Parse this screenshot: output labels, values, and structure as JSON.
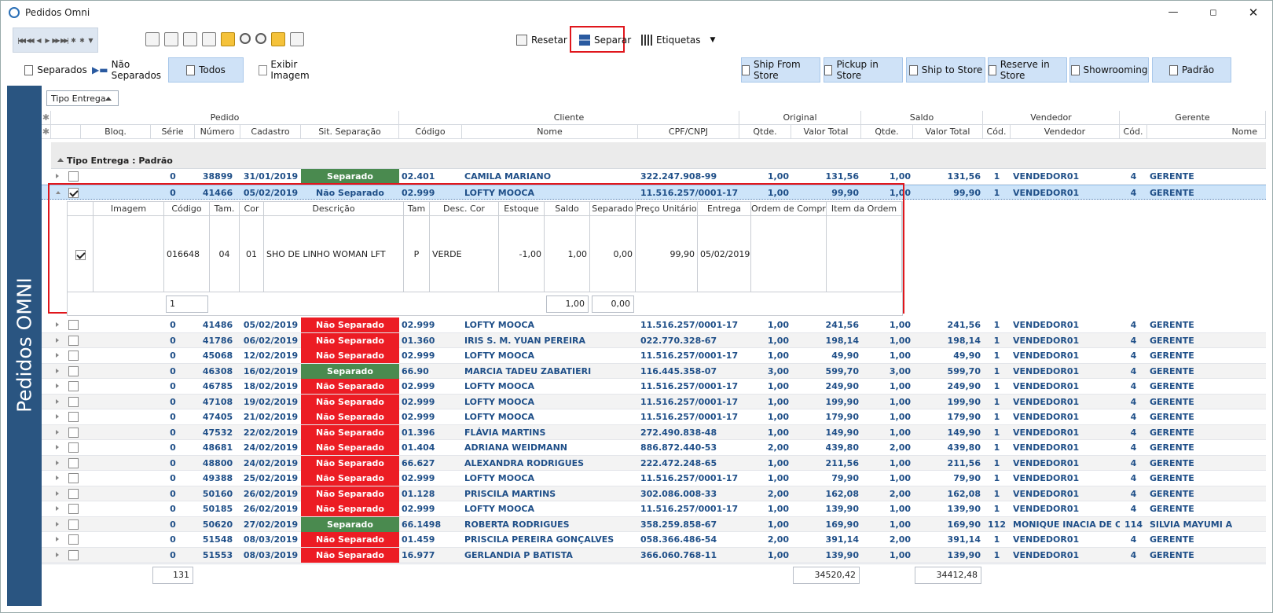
{
  "window": {
    "title": "Pedidos Omni"
  },
  "toolbar": {
    "reset_label": "Resetar",
    "separar_label": "Separar",
    "etiquetas_label": "Etiquetas"
  },
  "filters": {
    "separados": "Separados",
    "nao_separados": "Não Separados",
    "todos": "Todos",
    "exibir_imagem": "Exibir Imagem",
    "ship_from_store": "Ship From Store",
    "pickup_in_store": "Pickup in Store",
    "ship_to_store": "Ship to Store",
    "reserve_in_store": "Reserve in Store",
    "showrooming": "Showrooming",
    "padrao": "Padrão"
  },
  "sidebar": {
    "title": "Pedidos OMNI"
  },
  "grid": {
    "group_button": "Tipo Entrega",
    "band_headers": {
      "pedido": "Pedido",
      "cliente": "Cliente",
      "original": "Original",
      "saldo": "Saldo",
      "vendedor": "Vendedor",
      "gerente": "Gerente"
    },
    "columns": {
      "bloq": "Bloq.",
      "serie": "Série",
      "numero": "Número",
      "cadastro": "Cadastro",
      "sit": "Sit. Separação",
      "codigo": "Código",
      "nome": "Nome",
      "cpf": "CPF/CNPJ",
      "oqtde": "Qtde.",
      "ovalor": "Valor Total",
      "sqtde": "Qtde.",
      "svalor": "Valor Total",
      "vcod": "Cód.",
      "vendedor": "Vendedor",
      "gcod": "Cód.",
      "gnome": "Nome"
    },
    "group_label": "Tipo Entrega : Padrão",
    "rows": [
      {
        "serie": "0",
        "numero": "38899",
        "cadastro": "31/01/2019",
        "sit": "Separado",
        "codigo": "02.401",
        "nome": "CAMILA MARIANO",
        "cpf": "322.247.908-99",
        "oqtde": "1,00",
        "ovalor": "131,56",
        "sqtde": "1,00",
        "svalor": "131,56",
        "vcod": "1",
        "vendedor": "VENDEDOR01",
        "gcod": "4",
        "gnome": "GERENTE",
        "checked": false
      },
      {
        "serie": "0",
        "numero": "41466",
        "cadastro": "05/02/2019",
        "sit": "Não Separado",
        "codigo": "02.999",
        "nome": "LOFTY MOOCA",
        "cpf": "11.516.257/0001-17",
        "oqtde": "1,00",
        "ovalor": "99,90",
        "sqtde": "1,00",
        "svalor": "99,90",
        "vcod": "1",
        "vendedor": "VENDEDOR01",
        "gcod": "4",
        "gnome": "GERENTE",
        "checked": true
      },
      {
        "serie": "0",
        "numero": "41486",
        "cadastro": "05/02/2019",
        "sit": "Não Separado",
        "codigo": "02.999",
        "nome": "LOFTY MOOCA",
        "cpf": "11.516.257/0001-17",
        "oqtde": "1,00",
        "ovalor": "241,56",
        "sqtde": "1,00",
        "svalor": "241,56",
        "vcod": "1",
        "vendedor": "VENDEDOR01",
        "gcod": "4",
        "gnome": "GERENTE"
      },
      {
        "serie": "0",
        "numero": "41786",
        "cadastro": "06/02/2019",
        "sit": "Não Separado",
        "codigo": "01.360",
        "nome": "IRIS S. M. YUAN PEREIRA",
        "cpf": "022.770.328-67",
        "oqtde": "1,00",
        "ovalor": "198,14",
        "sqtde": "1,00",
        "svalor": "198,14",
        "vcod": "1",
        "vendedor": "VENDEDOR01",
        "gcod": "4",
        "gnome": "GERENTE"
      },
      {
        "serie": "0",
        "numero": "45068",
        "cadastro": "12/02/2019",
        "sit": "Não Separado",
        "codigo": "02.999",
        "nome": "LOFTY MOOCA",
        "cpf": "11.516.257/0001-17",
        "oqtde": "1,00",
        "ovalor": "49,90",
        "sqtde": "1,00",
        "svalor": "49,90",
        "vcod": "1",
        "vendedor": "VENDEDOR01",
        "gcod": "4",
        "gnome": "GERENTE"
      },
      {
        "serie": "0",
        "numero": "46308",
        "cadastro": "16/02/2019",
        "sit": "Separado",
        "codigo": "66.90",
        "nome": "MARCIA TADEU ZABATIERI",
        "cpf": "116.445.358-07",
        "oqtde": "3,00",
        "ovalor": "599,70",
        "sqtde": "3,00",
        "svalor": "599,70",
        "vcod": "1",
        "vendedor": "VENDEDOR01",
        "gcod": "4",
        "gnome": "GERENTE"
      },
      {
        "serie": "0",
        "numero": "46785",
        "cadastro": "18/02/2019",
        "sit": "Não Separado",
        "codigo": "02.999",
        "nome": "LOFTY MOOCA",
        "cpf": "11.516.257/0001-17",
        "oqtde": "1,00",
        "ovalor": "249,90",
        "sqtde": "1,00",
        "svalor": "249,90",
        "vcod": "1",
        "vendedor": "VENDEDOR01",
        "gcod": "4",
        "gnome": "GERENTE"
      },
      {
        "serie": "0",
        "numero": "47108",
        "cadastro": "19/02/2019",
        "sit": "Não Separado",
        "codigo": "02.999",
        "nome": "LOFTY MOOCA",
        "cpf": "11.516.257/0001-17",
        "oqtde": "1,00",
        "ovalor": "199,90",
        "sqtde": "1,00",
        "svalor": "199,90",
        "vcod": "1",
        "vendedor": "VENDEDOR01",
        "gcod": "4",
        "gnome": "GERENTE"
      },
      {
        "serie": "0",
        "numero": "47405",
        "cadastro": "21/02/2019",
        "sit": "Não Separado",
        "codigo": "02.999",
        "nome": "LOFTY MOOCA",
        "cpf": "11.516.257/0001-17",
        "oqtde": "1,00",
        "ovalor": "179,90",
        "sqtde": "1,00",
        "svalor": "179,90",
        "vcod": "1",
        "vendedor": "VENDEDOR01",
        "gcod": "4",
        "gnome": "GERENTE"
      },
      {
        "serie": "0",
        "numero": "47532",
        "cadastro": "22/02/2019",
        "sit": "Não Separado",
        "codigo": "01.396",
        "nome": "FLÁVIA MARTINS",
        "cpf": "272.490.838-48",
        "oqtde": "1,00",
        "ovalor": "149,90",
        "sqtde": "1,00",
        "svalor": "149,90",
        "vcod": "1",
        "vendedor": "VENDEDOR01",
        "gcod": "4",
        "gnome": "GERENTE"
      },
      {
        "serie": "0",
        "numero": "48681",
        "cadastro": "24/02/2019",
        "sit": "Não Separado",
        "codigo": "01.404",
        "nome": "ADRIANA WEIDMANN",
        "cpf": "886.872.440-53",
        "oqtde": "2,00",
        "ovalor": "439,80",
        "sqtde": "2,00",
        "svalor": "439,80",
        "vcod": "1",
        "vendedor": "VENDEDOR01",
        "gcod": "4",
        "gnome": "GERENTE"
      },
      {
        "serie": "0",
        "numero": "48800",
        "cadastro": "24/02/2019",
        "sit": "Não Separado",
        "codigo": "66.627",
        "nome": "ALEXANDRA RODRIGUES",
        "cpf": "222.472.248-65",
        "oqtde": "1,00",
        "ovalor": "211,56",
        "sqtde": "1,00",
        "svalor": "211,56",
        "vcod": "1",
        "vendedor": "VENDEDOR01",
        "gcod": "4",
        "gnome": "GERENTE"
      },
      {
        "serie": "0",
        "numero": "49388",
        "cadastro": "25/02/2019",
        "sit": "Não Separado",
        "codigo": "02.999",
        "nome": "LOFTY MOOCA",
        "cpf": "11.516.257/0001-17",
        "oqtde": "1,00",
        "ovalor": "79,90",
        "sqtde": "1,00",
        "svalor": "79,90",
        "vcod": "1",
        "vendedor": "VENDEDOR01",
        "gcod": "4",
        "gnome": "GERENTE"
      },
      {
        "serie": "0",
        "numero": "50160",
        "cadastro": "26/02/2019",
        "sit": "Não Separado",
        "codigo": "01.128",
        "nome": "PRISCILA MARTINS",
        "cpf": "302.086.008-33",
        "oqtde": "2,00",
        "ovalor": "162,08",
        "sqtde": "2,00",
        "svalor": "162,08",
        "vcod": "1",
        "vendedor": "VENDEDOR01",
        "gcod": "4",
        "gnome": "GERENTE"
      },
      {
        "serie": "0",
        "numero": "50185",
        "cadastro": "26/02/2019",
        "sit": "Não Separado",
        "codigo": "02.999",
        "nome": "LOFTY MOOCA",
        "cpf": "11.516.257/0001-17",
        "oqtde": "1,00",
        "ovalor": "139,90",
        "sqtde": "1,00",
        "svalor": "139,90",
        "vcod": "1",
        "vendedor": "VENDEDOR01",
        "gcod": "4",
        "gnome": "GERENTE"
      },
      {
        "serie": "0",
        "numero": "50620",
        "cadastro": "27/02/2019",
        "sit": "Separado",
        "codigo": "66.1498",
        "nome": "ROBERTA RODRIGUES",
        "cpf": "358.259.858-67",
        "oqtde": "1,00",
        "ovalor": "169,90",
        "sqtde": "1,00",
        "svalor": "169,90",
        "vcod": "112",
        "vendedor": "MONIQUE INACIA DE OLIV",
        "gcod": "114",
        "gnome": "SILVIA MAYUMI A"
      },
      {
        "serie": "0",
        "numero": "51548",
        "cadastro": "08/03/2019",
        "sit": "Não Separado",
        "codigo": "01.459",
        "nome": "PRISCILA PEREIRA GONÇALVES",
        "cpf": "058.366.486-54",
        "oqtde": "2,00",
        "ovalor": "391,14",
        "sqtde": "2,00",
        "svalor": "391,14",
        "vcod": "1",
        "vendedor": "VENDEDOR01",
        "gcod": "4",
        "gnome": "GERENTE"
      },
      {
        "serie": "0",
        "numero": "51553",
        "cadastro": "08/03/2019",
        "sit": "Não Separado",
        "codigo": "16.977",
        "nome": "GERLANDIA P BATISTA",
        "cpf": "366.060.768-11",
        "oqtde": "1,00",
        "ovalor": "139,90",
        "sqtde": "1,00",
        "svalor": "139,90",
        "vcod": "1",
        "vendedor": "VENDEDOR01",
        "gcod": "4",
        "gnome": "GERENTE"
      }
    ],
    "detail": {
      "columns": {
        "imagem": "Imagem",
        "codigo": "Código",
        "tam": "Tam.",
        "cor": "Cor",
        "descricao": "Descrição",
        "tam2": "Tam",
        "desc_cor": "Desc. Cor",
        "estoque": "Estoque",
        "saldo": "Saldo",
        "separado": "Separado",
        "preco": "Preço Unitário",
        "entrega": "Entrega",
        "ordem": "Ordem de Compra",
        "item": "Item da Ordem"
      },
      "row": {
        "codigo": "016648",
        "tam": "04",
        "cor": "01",
        "descricao": "SHO DE LINHO WOMAN LFT",
        "tam2": "P",
        "desc_cor": "VERDE",
        "estoque": "-1,00",
        "saldo": "1,00",
        "separado": "0,00",
        "preco": "99,90",
        "entrega": "05/02/2019"
      },
      "footer": {
        "count": "1",
        "saldo": "1,00",
        "separado": "0,00"
      }
    },
    "footer": {
      "count": "131",
      "valor_original": "34520,42",
      "valor_saldo": "34412,48"
    }
  },
  "colors": {
    "separado": "#4a8a4f",
    "nao_separado": "#ec1c24",
    "sidebar": "#2a5581",
    "highlight": "#e0161c"
  }
}
